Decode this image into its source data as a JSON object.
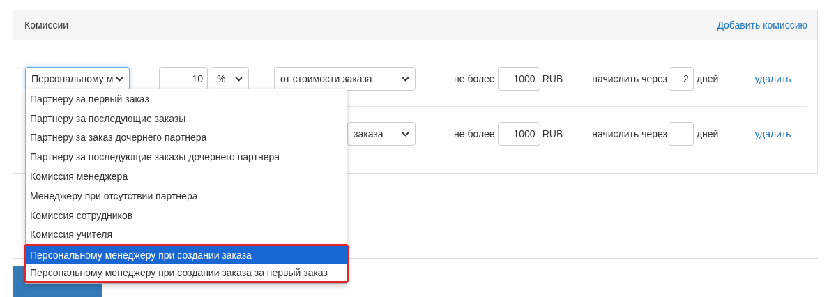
{
  "panel": {
    "title": "Комиссии",
    "add_link": "Добавить комиссию"
  },
  "rows": [
    {
      "type_select": {
        "value": "Персональному м",
        "focused": true
      },
      "amount": "10",
      "unit": "%",
      "basis": "от стоимости заказа",
      "limit_label": "не более",
      "limit": "1000",
      "currency": "RUB",
      "delay_label": "начислить через",
      "delay": "2",
      "days_label": "дней",
      "delete": "удалить"
    },
    {
      "basis": "заказа",
      "limit_label": "не более",
      "limit": "1000",
      "currency": "RUB",
      "delay_label": "начислить через",
      "days_label": "дней",
      "delete": "удалить"
    }
  ],
  "dropdown": {
    "items": [
      {
        "label": "Партнеру за первый заказ",
        "selected": false,
        "highlighted": false
      },
      {
        "label": "Партнеру за последующие заказы",
        "selected": false,
        "highlighted": false
      },
      {
        "label": "Партнеру за заказ дочернего партнера",
        "selected": false,
        "highlighted": false
      },
      {
        "label": "Партнеру за последующие заказы дочернего партнера",
        "selected": false,
        "highlighted": false
      },
      {
        "label": "Комиссия менеджера",
        "selected": false,
        "highlighted": false
      },
      {
        "label": "Менеджеру при отсутствии партнера",
        "selected": false,
        "highlighted": false
      },
      {
        "label": "Комиссия сотрудников",
        "selected": false,
        "highlighted": false
      },
      {
        "label": "Комиссия учителя",
        "selected": false,
        "highlighted": false
      },
      {
        "label": "Персональному менеджеру при создании заказа",
        "selected": true,
        "highlighted": true
      },
      {
        "label": "Персональному менеджеру при создании заказа за первый заказ",
        "selected": false,
        "highlighted": true
      }
    ]
  },
  "footer": {
    "save_button": {
      "kind": "button"
    }
  }
}
